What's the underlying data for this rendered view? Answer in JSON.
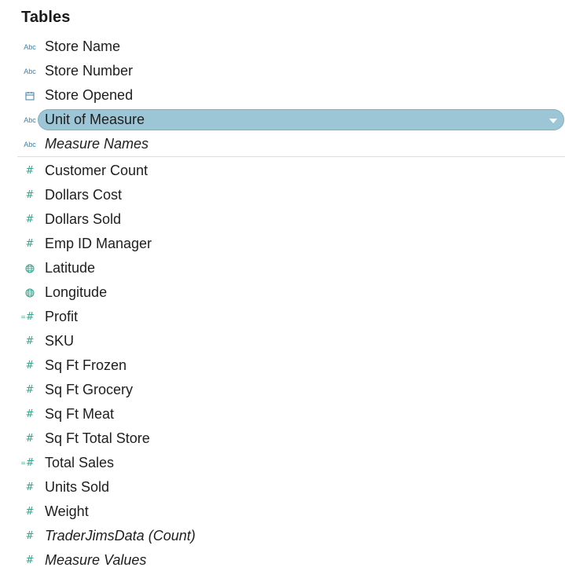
{
  "panel": {
    "title": "Tables"
  },
  "dimensions": [
    {
      "label": "Store Name",
      "icon": "abc-string-icon",
      "icon_text": "Abc"
    },
    {
      "label": "Store Number",
      "icon": "abc-string-icon",
      "icon_text": "Abc"
    },
    {
      "label": "Store Opened",
      "icon": "calendar-icon",
      "icon_text": ""
    },
    {
      "label": "Unit of Measure",
      "icon": "abc-string-icon",
      "icon_text": "Abc",
      "selected": true
    },
    {
      "label": "Measure Names",
      "icon": "abc-string-icon",
      "icon_text": "Abc",
      "italic": true
    }
  ],
  "measures": [
    {
      "label": "Customer Count",
      "icon": "number-icon",
      "icon_text": "#"
    },
    {
      "label": "Dollars Cost",
      "icon": "number-icon",
      "icon_text": "#"
    },
    {
      "label": "Dollars Sold",
      "icon": "number-icon",
      "icon_text": "#"
    },
    {
      "label": "Emp ID Manager",
      "icon": "number-icon",
      "icon_text": "#"
    },
    {
      "label": "Latitude",
      "icon": "globe-icon",
      "icon_text": ""
    },
    {
      "label": "Longitude",
      "icon": "globe-icon",
      "icon_text": ""
    },
    {
      "label": "Profit",
      "icon": "calculated-number-icon",
      "icon_text": "#"
    },
    {
      "label": "SKU",
      "icon": "number-icon",
      "icon_text": "#"
    },
    {
      "label": "Sq Ft Frozen",
      "icon": "number-icon",
      "icon_text": "#"
    },
    {
      "label": "Sq Ft Grocery",
      "icon": "number-icon",
      "icon_text": "#"
    },
    {
      "label": "Sq Ft Meat",
      "icon": "number-icon",
      "icon_text": "#"
    },
    {
      "label": "Sq Ft Total Store",
      "icon": "number-icon",
      "icon_text": "#"
    },
    {
      "label": "Total Sales",
      "icon": "calculated-number-icon",
      "icon_text": "#"
    },
    {
      "label": "Units Sold",
      "icon": "number-icon",
      "icon_text": "#"
    },
    {
      "label": "Weight",
      "icon": "number-icon",
      "icon_text": "#"
    },
    {
      "label": "TraderJimsData (Count)",
      "icon": "number-icon",
      "icon_text": "#",
      "italic": true
    },
    {
      "label": "Measure Values",
      "icon": "number-icon",
      "icon_text": "#",
      "italic": true
    }
  ],
  "colors": {
    "dimension_icon": "#3f7fa0",
    "measure_icon": "#3aa38c",
    "selected_pill": "#9cc6d6"
  }
}
